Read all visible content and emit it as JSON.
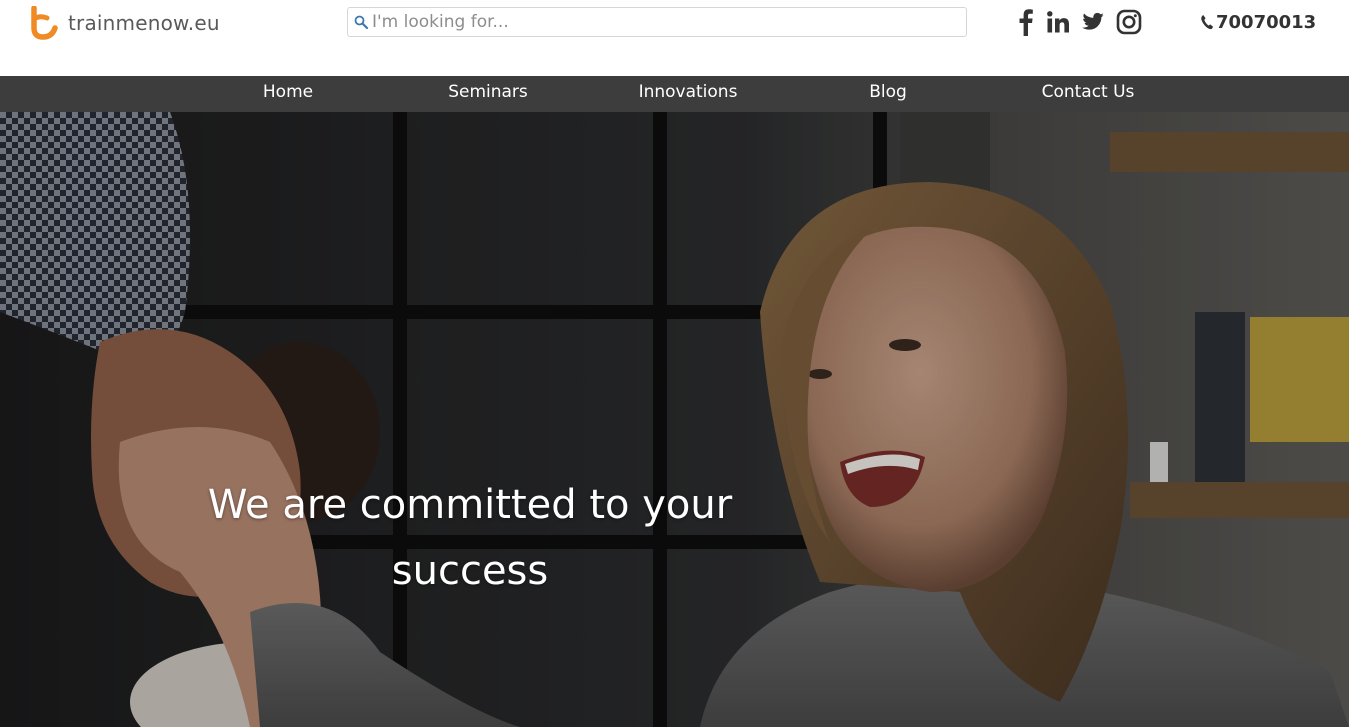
{
  "header": {
    "logo_text": "trainmenow.eu",
    "search_placeholder": "I'm looking for...",
    "social_icons": [
      "facebook-icon",
      "linkedin-icon",
      "twitter-icon",
      "instagram-icon"
    ],
    "phone": "70070013"
  },
  "nav": {
    "items": [
      {
        "label": "Home"
      },
      {
        "label": "Seminars"
      },
      {
        "label": "Innovations"
      },
      {
        "label": "Blog"
      },
      {
        "label": "Contact Us"
      }
    ]
  },
  "hero": {
    "headline": "We are committed to your success"
  },
  "colors": {
    "brand_orange": "#f08a24",
    "nav_bg": "#3d3d3d",
    "text_dark": "#333333"
  }
}
